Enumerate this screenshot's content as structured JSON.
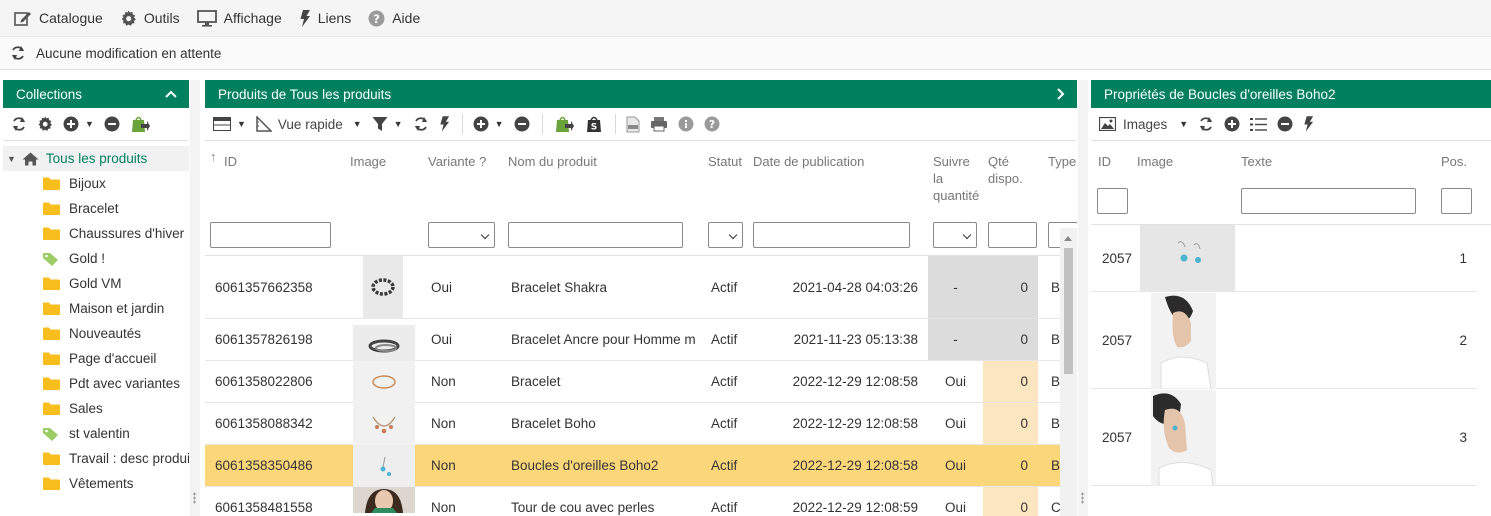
{
  "menu": [
    {
      "label": "Catalogue",
      "icon": "edit-icon"
    },
    {
      "label": "Outils",
      "icon": "gear-icon"
    },
    {
      "label": "Affichage",
      "icon": "monitor-icon"
    },
    {
      "label": "Liens",
      "icon": "bolt-icon"
    },
    {
      "label": "Aide",
      "icon": "help-icon"
    }
  ],
  "status": {
    "text": "Aucune modification en attente"
  },
  "collections": {
    "title": "Collections",
    "root": "Tous les produits",
    "items": [
      {
        "label": "Bijoux",
        "icon": "folder"
      },
      {
        "label": "Bracelet",
        "icon": "folder"
      },
      {
        "label": "Chaussures d'hiver",
        "icon": "folder"
      },
      {
        "label": "Gold !",
        "icon": "tag"
      },
      {
        "label": "Gold VM",
        "icon": "folder"
      },
      {
        "label": "Maison et jardin",
        "icon": "folder"
      },
      {
        "label": "Nouveautés",
        "icon": "folder"
      },
      {
        "label": "Page d'accueil",
        "icon": "folder"
      },
      {
        "label": "Pdt avec variantes",
        "icon": "folder"
      },
      {
        "label": "Sales",
        "icon": "folder"
      },
      {
        "label": "st valentin",
        "icon": "tag"
      },
      {
        "label": "Travail : desc produit",
        "icon": "folder"
      },
      {
        "label": "Vêtements",
        "icon": "folder"
      }
    ]
  },
  "products": {
    "title": "Produits de Tous les produits",
    "view_label": "Vue rapide",
    "columns": {
      "id": "ID",
      "image": "Image",
      "variant": "Variante ?",
      "name": "Nom du produit",
      "status": "Statut",
      "published": "Date de publication",
      "track_l1": "Suivre",
      "track_l2": "la",
      "track_l3": "quantité",
      "qty_l1": "Qté",
      "qty_l2": "dispo.",
      "type": "Type"
    },
    "rows": [
      {
        "id": "6061357662358",
        "variant": "Oui",
        "name": "Bracelet Shakra",
        "status": "Actif",
        "date": "2021-04-28 04:03:26",
        "track": "-",
        "qty": "0",
        "type": "B"
      },
      {
        "id": "6061357826198",
        "variant": "Oui",
        "name": "Bracelet Ancre pour Homme m",
        "status": "Actif",
        "date": "2021-11-23 05:13:38",
        "track": "-",
        "qty": "0",
        "type": "B"
      },
      {
        "id": "6061358022806",
        "variant": "Non",
        "name": "Bracelet",
        "status": "Actif",
        "date": "2022-12-29 12:08:58",
        "track": "Oui",
        "qty": "0",
        "type": "B"
      },
      {
        "id": "6061358088342",
        "variant": "Non",
        "name": "Bracelet Boho",
        "status": "Actif",
        "date": "2022-12-29 12:08:58",
        "track": "Oui",
        "qty": "0",
        "type": "B"
      },
      {
        "id": "6061358350486",
        "variant": "Non",
        "name": "Boucles d'oreilles Boho2",
        "status": "Actif",
        "date": "2022-12-29 12:08:58",
        "track": "Oui",
        "qty": "0",
        "type": "B"
      },
      {
        "id": "6061358481558",
        "variant": "Non",
        "name": "Tour de cou avec perles",
        "status": "Actif",
        "date": "2022-12-29 12:08:59",
        "track": "Oui",
        "qty": "0",
        "type": "C"
      }
    ]
  },
  "properties": {
    "title": "Propriétés de Boucles d'oreilles Boho2",
    "images_label": "Images",
    "columns": {
      "id": "ID",
      "image": "Image",
      "text": "Texte",
      "pos": "Pos."
    },
    "rows": [
      {
        "id": "2057",
        "pos": "1"
      },
      {
        "id": "2057",
        "pos": "2"
      },
      {
        "id": "2057",
        "pos": "3"
      }
    ]
  },
  "colors": {
    "brand": "#00805f",
    "selected_row": "#fcd77a",
    "accent_cream": "#fbe6bf"
  }
}
